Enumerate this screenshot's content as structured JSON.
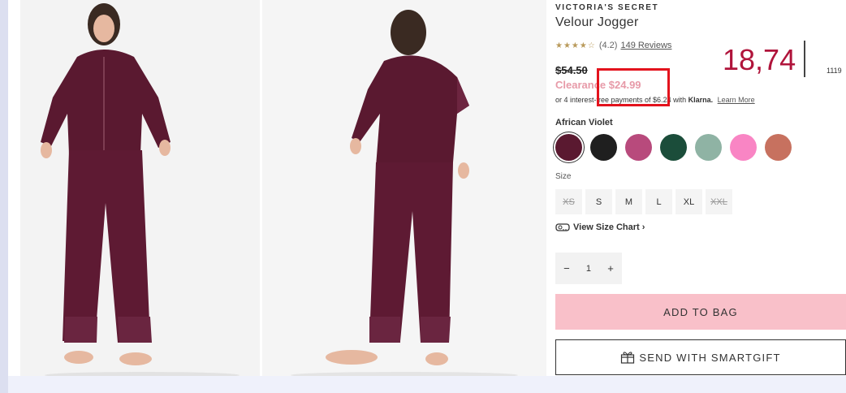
{
  "product": {
    "brand": "VICTORIA'S SECRET",
    "title": "Velour Jogger",
    "rating_stars": "★★★★☆",
    "rating_value": "(4.2)",
    "reviews_label": "149 Reviews",
    "original_price": "$54.50",
    "sale_price": "Clearance $24.99",
    "installments_text": "or 4 interest-free payments of $6.24 with",
    "klarna_label": "Klarna.",
    "learn_more": "Learn More"
  },
  "overlay": {
    "annotation_value": "18,74",
    "small_value": "1119"
  },
  "colors": {
    "selected_label": "African Violet",
    "swatches": [
      {
        "name": "african-violet",
        "hex": "#5a1930"
      },
      {
        "name": "black",
        "hex": "#1f1f1f"
      },
      {
        "name": "berry",
        "hex": "#b84a7c"
      },
      {
        "name": "green",
        "hex": "#1b4d3a"
      },
      {
        "name": "sage",
        "hex": "#8fb3a4"
      },
      {
        "name": "pink",
        "hex": "#f985c4"
      },
      {
        "name": "terracotta",
        "hex": "#c7715f"
      }
    ]
  },
  "sizes": {
    "label": "Size",
    "options": [
      {
        "label": "XS",
        "available": false
      },
      {
        "label": "S",
        "available": true
      },
      {
        "label": "M",
        "available": true
      },
      {
        "label": "L",
        "available": true
      },
      {
        "label": "XL",
        "available": true
      },
      {
        "label": "XXL",
        "available": false
      }
    ],
    "size_chart_label": "View Size Chart ›"
  },
  "quantity": {
    "minus": "−",
    "value": "1",
    "plus": "+"
  },
  "actions": {
    "add_to_bag": "ADD TO BAG",
    "send_gift": "SEND WITH SMARTGIFT"
  },
  "theme": {
    "accent_pink": "#f9c0c9",
    "sale_color": "#e79aa8",
    "highlight_red": "#e3131d",
    "overlay_red": "#b0143b"
  }
}
